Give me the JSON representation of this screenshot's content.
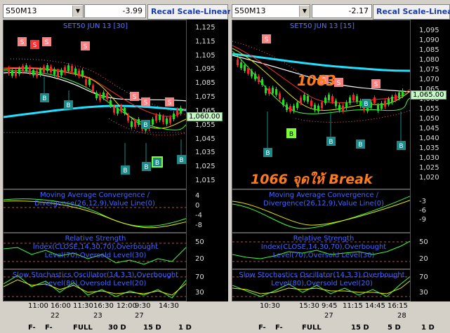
{
  "left": {
    "symbol": "S50M13",
    "change": "-3.99",
    "recal_label": "Recal Scale-Linear",
    "chart_title": "SET50 JUN 13   [30]",
    "price_ticks": [
      "1,125",
      "1,115",
      "1,105",
      "1,095",
      "1,085",
      "1,075",
      "1,065",
      "1,055",
      "1,045",
      "1,035",
      "1,025",
      "1,015"
    ],
    "last_price": "1,060.00",
    "macd_label": "Moving Average Convergence / Divergence(26,12,9),Value Line(0)",
    "macd_ticks": [
      "4",
      "0",
      "-4",
      "-8"
    ],
    "rsi_label": "Relative Strength Index(CLOSE,14,30,70),Overbought Level(70),Oversold Level(30)",
    "rsi_ticks": [
      "50",
      "20"
    ],
    "stoch_label": "Slow Stochastics Oscillator(14,3,3),Overbought Level(80),Oversold Level(20)",
    "stoch_ticks": [
      "70",
      "30"
    ],
    "time_labels": [
      "11:00",
      "16:00",
      "11:30",
      "16:30",
      "12:00",
      "9:30",
      "14:30"
    ],
    "date_labels": [
      "22",
      "23",
      "27"
    ],
    "buttons": [
      "F-",
      "F-",
      "FULL",
      "30 D",
      "15 D",
      "1 D"
    ]
  },
  "right": {
    "symbol": "S50M13",
    "change": "-2.17",
    "recal_label": "Recal Scale-Linear",
    "chart_title": "SET50 JUN 13   [15]",
    "price_ticks": [
      "1,095",
      "1,090",
      "1,085",
      "1,080",
      "1,075",
      "1,070",
      "1,065",
      "1,060",
      "1,055",
      "1,050",
      "1,045",
      "1,040",
      "1,035",
      "1,030",
      "1,025",
      "1,020"
    ],
    "last_price": "1,065.00",
    "annotation_1063": "1063",
    "annotation_break": "1066 จุดให้ Break",
    "macd_label": "Moving Average Convergence / Divergence(26,12,9),Value Line(0)",
    "macd_ticks": [
      "-3",
      "-6",
      "-9"
    ],
    "rsi_label": "Relative Strength Index(CLOSE,14,30,70),Overbought Level(70),Oversold Level(30)",
    "rsi_ticks": [
      "50",
      "20"
    ],
    "stoch_label": "Slow Stochastics Oscillator(14,3,3),Overbought Level(80),Oversold Level(20)",
    "stoch_ticks": [
      "70",
      "30"
    ],
    "time_labels": [
      "10:30",
      "15:30",
      "9:45",
      "11:15",
      "14:45",
      "16:15"
    ],
    "date_labels": [
      "27",
      "28"
    ],
    "buttons": [
      "F-",
      "F-",
      "FULL",
      "15 D",
      "5 D",
      "1 D"
    ]
  },
  "colors": {
    "buy": "#1a8a8a",
    "sell": "#ff6b6b",
    "ema_cyan": "#22e0ff",
    "up_candle": "#22dd22",
    "down_candle": "#ff2222",
    "panel_bg": "#000000"
  }
}
